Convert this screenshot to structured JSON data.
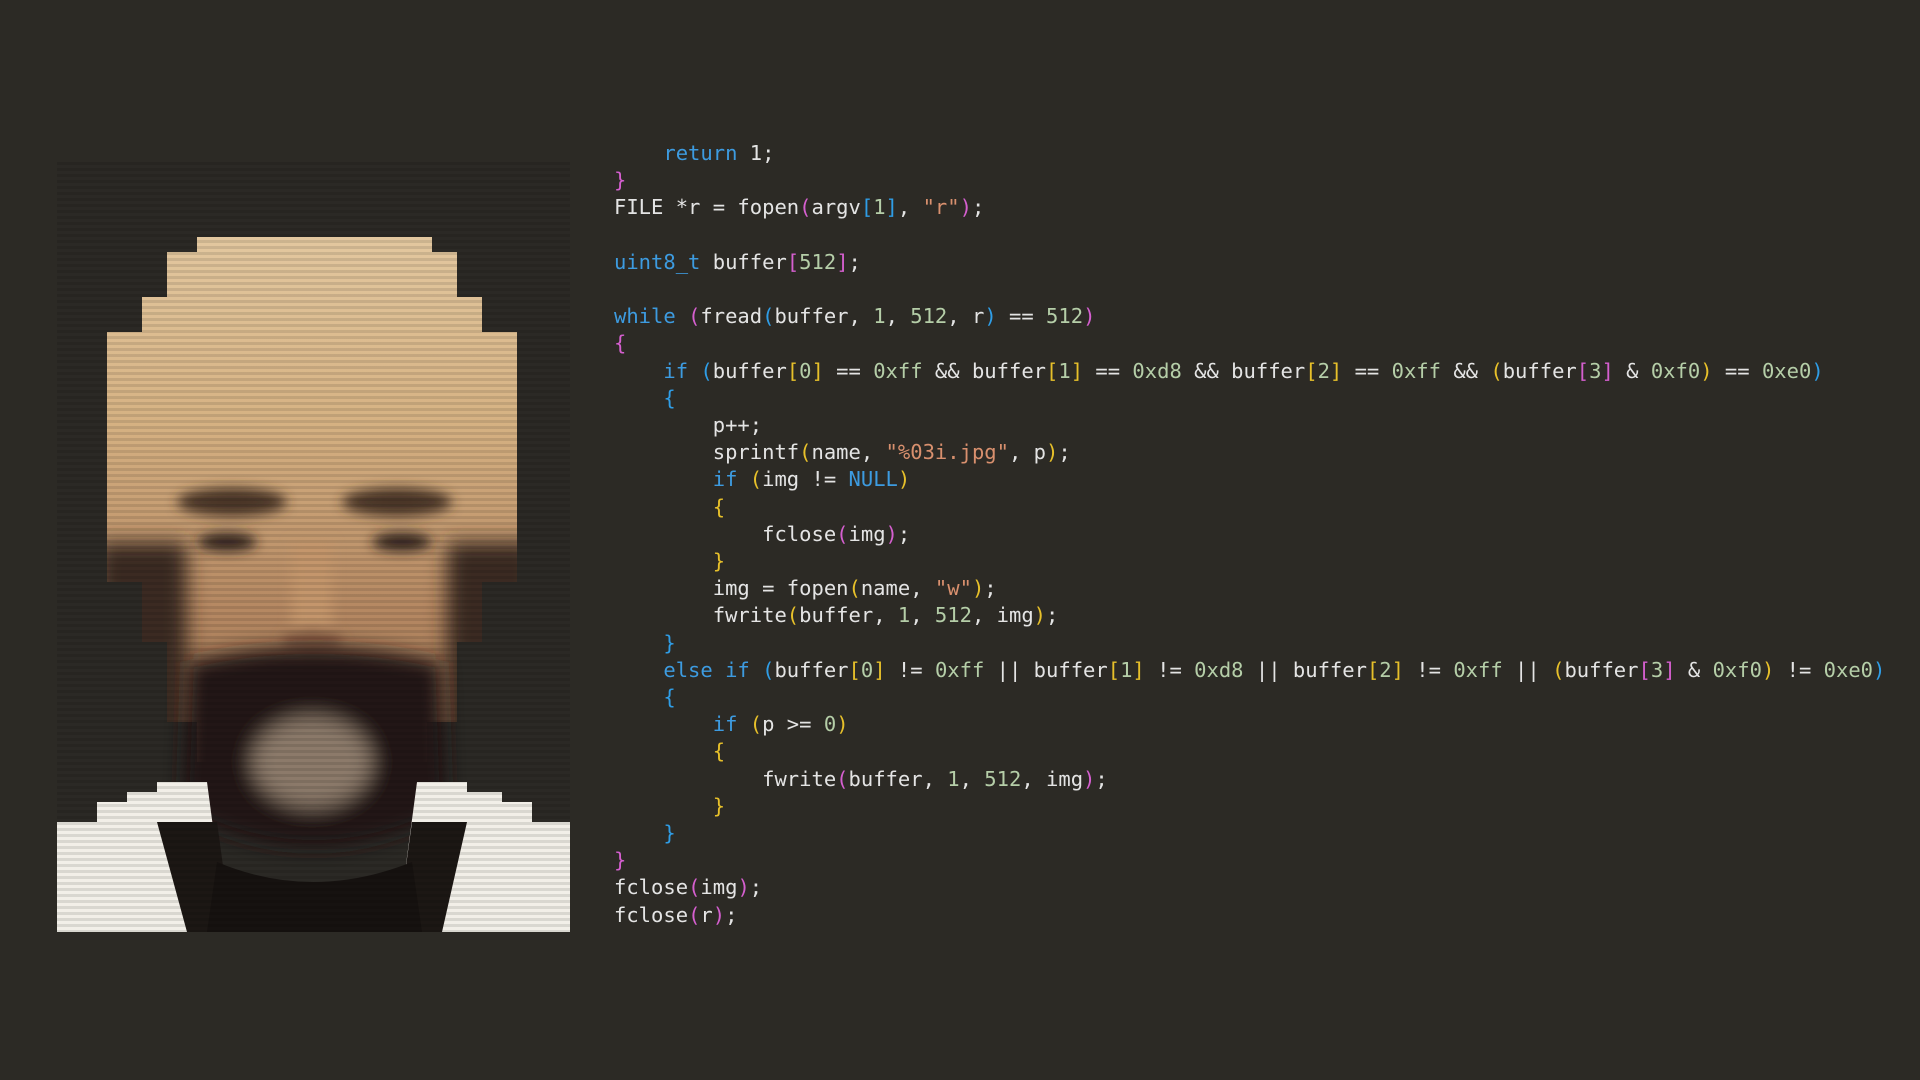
{
  "code": {
    "lines": [
      [
        {
          "t": "    ",
          "c": "plain"
        },
        {
          "t": "return",
          "c": "kw"
        },
        {
          "t": " 1;",
          "c": "plain"
        }
      ],
      [
        {
          "t": "}",
          "c": "p1"
        }
      ],
      [
        {
          "t": "FILE *r = fopen",
          "c": "plain"
        },
        {
          "t": "(",
          "c": "p1"
        },
        {
          "t": "argv",
          "c": "plain"
        },
        {
          "t": "[",
          "c": "p2"
        },
        {
          "t": "1",
          "c": "num"
        },
        {
          "t": "]",
          "c": "p2"
        },
        {
          "t": ", ",
          "c": "plain"
        },
        {
          "t": "\"r\"",
          "c": "str"
        },
        {
          "t": ")",
          "c": "p1"
        },
        {
          "t": ";",
          "c": "plain"
        }
      ],
      [],
      [
        {
          "t": "uint8_t",
          "c": "type"
        },
        {
          "t": " buffer",
          "c": "plain"
        },
        {
          "t": "[",
          "c": "p1"
        },
        {
          "t": "512",
          "c": "num"
        },
        {
          "t": "]",
          "c": "p1"
        },
        {
          "t": ";",
          "c": "plain"
        }
      ],
      [],
      [
        {
          "t": "while",
          "c": "kw"
        },
        {
          "t": " ",
          "c": "plain"
        },
        {
          "t": "(",
          "c": "p1"
        },
        {
          "t": "fread",
          "c": "plain"
        },
        {
          "t": "(",
          "c": "p2"
        },
        {
          "t": "buffer, ",
          "c": "plain"
        },
        {
          "t": "1",
          "c": "num"
        },
        {
          "t": ", ",
          "c": "plain"
        },
        {
          "t": "512",
          "c": "num"
        },
        {
          "t": ", r",
          "c": "plain"
        },
        {
          "t": ")",
          "c": "p2"
        },
        {
          "t": " == ",
          "c": "plain"
        },
        {
          "t": "512",
          "c": "num"
        },
        {
          "t": ")",
          "c": "p1"
        }
      ],
      [
        {
          "t": "{",
          "c": "p1"
        }
      ],
      [
        {
          "t": "    ",
          "c": "plain"
        },
        {
          "t": "if",
          "c": "kw"
        },
        {
          "t": " ",
          "c": "plain"
        },
        {
          "t": "(",
          "c": "p2"
        },
        {
          "t": "buffer",
          "c": "plain"
        },
        {
          "t": "[",
          "c": "p3"
        },
        {
          "t": "0",
          "c": "num"
        },
        {
          "t": "]",
          "c": "p3"
        },
        {
          "t": " == ",
          "c": "plain"
        },
        {
          "t": "0xff",
          "c": "num"
        },
        {
          "t": " && buffer",
          "c": "plain"
        },
        {
          "t": "[",
          "c": "p3"
        },
        {
          "t": "1",
          "c": "num"
        },
        {
          "t": "]",
          "c": "p3"
        },
        {
          "t": " == ",
          "c": "plain"
        },
        {
          "t": "0xd8",
          "c": "num"
        },
        {
          "t": " && buffer",
          "c": "plain"
        },
        {
          "t": "[",
          "c": "p3"
        },
        {
          "t": "2",
          "c": "num"
        },
        {
          "t": "]",
          "c": "p3"
        },
        {
          "t": " == ",
          "c": "plain"
        },
        {
          "t": "0xff",
          "c": "num"
        },
        {
          "t": " && ",
          "c": "plain"
        },
        {
          "t": "(",
          "c": "p3"
        },
        {
          "t": "buffer",
          "c": "plain"
        },
        {
          "t": "[",
          "c": "p1"
        },
        {
          "t": "3",
          "c": "num"
        },
        {
          "t": "]",
          "c": "p1"
        },
        {
          "t": " & ",
          "c": "plain"
        },
        {
          "t": "0xf0",
          "c": "num"
        },
        {
          "t": ")",
          "c": "p3"
        },
        {
          "t": " == ",
          "c": "plain"
        },
        {
          "t": "0xe0",
          "c": "num"
        },
        {
          "t": ")",
          "c": "p2"
        }
      ],
      [
        {
          "t": "    ",
          "c": "plain"
        },
        {
          "t": "{",
          "c": "p2"
        }
      ],
      [
        {
          "t": "        p++;",
          "c": "plain"
        }
      ],
      [
        {
          "t": "        sprintf",
          "c": "plain"
        },
        {
          "t": "(",
          "c": "p3"
        },
        {
          "t": "name, ",
          "c": "plain"
        },
        {
          "t": "\"%03i.jpg\"",
          "c": "str"
        },
        {
          "t": ", p",
          "c": "plain"
        },
        {
          "t": ")",
          "c": "p3"
        },
        {
          "t": ";",
          "c": "plain"
        }
      ],
      [
        {
          "t": "        ",
          "c": "plain"
        },
        {
          "t": "if",
          "c": "kw"
        },
        {
          "t": " ",
          "c": "plain"
        },
        {
          "t": "(",
          "c": "p3"
        },
        {
          "t": "img != ",
          "c": "plain"
        },
        {
          "t": "NULL",
          "c": "const"
        },
        {
          "t": ")",
          "c": "p3"
        }
      ],
      [
        {
          "t": "        ",
          "c": "plain"
        },
        {
          "t": "{",
          "c": "p3"
        }
      ],
      [
        {
          "t": "            fclose",
          "c": "plain"
        },
        {
          "t": "(",
          "c": "p1"
        },
        {
          "t": "img",
          "c": "plain"
        },
        {
          "t": ")",
          "c": "p1"
        },
        {
          "t": ";",
          "c": "plain"
        }
      ],
      [
        {
          "t": "        ",
          "c": "plain"
        },
        {
          "t": "}",
          "c": "p3"
        }
      ],
      [
        {
          "t": "        img = fopen",
          "c": "plain"
        },
        {
          "t": "(",
          "c": "p3"
        },
        {
          "t": "name, ",
          "c": "plain"
        },
        {
          "t": "\"w\"",
          "c": "str"
        },
        {
          "t": ")",
          "c": "p3"
        },
        {
          "t": ";",
          "c": "plain"
        }
      ],
      [
        {
          "t": "        fwrite",
          "c": "plain"
        },
        {
          "t": "(",
          "c": "p3"
        },
        {
          "t": "buffer, ",
          "c": "plain"
        },
        {
          "t": "1",
          "c": "num"
        },
        {
          "t": ", ",
          "c": "plain"
        },
        {
          "t": "512",
          "c": "num"
        },
        {
          "t": ", img",
          "c": "plain"
        },
        {
          "t": ")",
          "c": "p3"
        },
        {
          "t": ";",
          "c": "plain"
        }
      ],
      [
        {
          "t": "    ",
          "c": "plain"
        },
        {
          "t": "}",
          "c": "p2"
        }
      ],
      [
        {
          "t": "    ",
          "c": "plain"
        },
        {
          "t": "else if",
          "c": "kw"
        },
        {
          "t": " ",
          "c": "plain"
        },
        {
          "t": "(",
          "c": "p2"
        },
        {
          "t": "buffer",
          "c": "plain"
        },
        {
          "t": "[",
          "c": "p3"
        },
        {
          "t": "0",
          "c": "num"
        },
        {
          "t": "]",
          "c": "p3"
        },
        {
          "t": " != ",
          "c": "plain"
        },
        {
          "t": "0xff",
          "c": "num"
        },
        {
          "t": " || buffer",
          "c": "plain"
        },
        {
          "t": "[",
          "c": "p3"
        },
        {
          "t": "1",
          "c": "num"
        },
        {
          "t": "]",
          "c": "p3"
        },
        {
          "t": " != ",
          "c": "plain"
        },
        {
          "t": "0xd8",
          "c": "num"
        },
        {
          "t": " || buffer",
          "c": "plain"
        },
        {
          "t": "[",
          "c": "p3"
        },
        {
          "t": "2",
          "c": "num"
        },
        {
          "t": "]",
          "c": "p3"
        },
        {
          "t": " != ",
          "c": "plain"
        },
        {
          "t": "0xff",
          "c": "num"
        },
        {
          "t": " || ",
          "c": "plain"
        },
        {
          "t": "(",
          "c": "p3"
        },
        {
          "t": "buffer",
          "c": "plain"
        },
        {
          "t": "[",
          "c": "p1"
        },
        {
          "t": "3",
          "c": "num"
        },
        {
          "t": "]",
          "c": "p1"
        },
        {
          "t": " & ",
          "c": "plain"
        },
        {
          "t": "0xf0",
          "c": "num"
        },
        {
          "t": ")",
          "c": "p3"
        },
        {
          "t": " != ",
          "c": "plain"
        },
        {
          "t": "0xe0",
          "c": "num"
        },
        {
          "t": ")",
          "c": "p2"
        }
      ],
      [
        {
          "t": "    ",
          "c": "plain"
        },
        {
          "t": "{",
          "c": "p2"
        }
      ],
      [
        {
          "t": "        ",
          "c": "plain"
        },
        {
          "t": "if",
          "c": "kw"
        },
        {
          "t": " ",
          "c": "plain"
        },
        {
          "t": "(",
          "c": "p3"
        },
        {
          "t": "p >= ",
          "c": "plain"
        },
        {
          "t": "0",
          "c": "num"
        },
        {
          "t": ")",
          "c": "p3"
        }
      ],
      [
        {
          "t": "        ",
          "c": "plain"
        },
        {
          "t": "{",
          "c": "p3"
        }
      ],
      [
        {
          "t": "            fwrite",
          "c": "plain"
        },
        {
          "t": "(",
          "c": "p1"
        },
        {
          "t": "buffer, ",
          "c": "plain"
        },
        {
          "t": "1",
          "c": "num"
        },
        {
          "t": ", ",
          "c": "plain"
        },
        {
          "t": "512",
          "c": "num"
        },
        {
          "t": ", img",
          "c": "plain"
        },
        {
          "t": ")",
          "c": "p1"
        },
        {
          "t": ";",
          "c": "plain"
        }
      ],
      [
        {
          "t": "        ",
          "c": "plain"
        },
        {
          "t": "}",
          "c": "p3"
        }
      ],
      [
        {
          "t": "    ",
          "c": "plain"
        },
        {
          "t": "}",
          "c": "p2"
        }
      ],
      [
        {
          "t": "}",
          "c": "p1"
        }
      ],
      [
        {
          "t": "fclose",
          "c": "plain"
        },
        {
          "t": "(",
          "c": "p1"
        },
        {
          "t": "img",
          "c": "plain"
        },
        {
          "t": ")",
          "c": "p1"
        },
        {
          "t": ";",
          "c": "plain"
        }
      ],
      [
        {
          "t": "fclose",
          "c": "plain"
        },
        {
          "t": "(",
          "c": "p1"
        },
        {
          "t": "r",
          "c": "plain"
        },
        {
          "t": ")",
          "c": "p1"
        },
        {
          "t": ";",
          "c": "plain"
        }
      ]
    ]
  }
}
